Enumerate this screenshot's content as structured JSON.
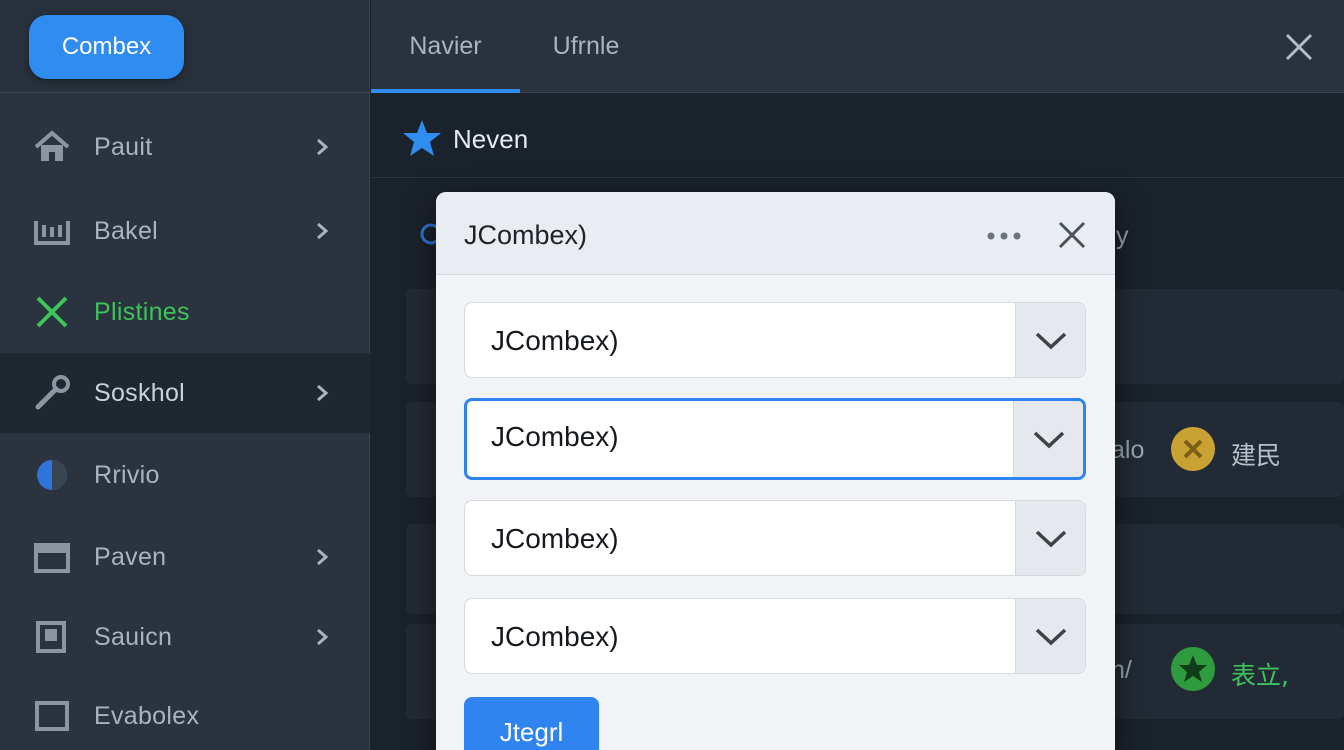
{
  "sidebar": {
    "brand_label": "Combex",
    "items": [
      {
        "label": "Pauit",
        "icon": "home-icon"
      },
      {
        "label": "Bakel",
        "icon": "tools-icon"
      },
      {
        "label": "Plistines",
        "icon": "close-x-icon",
        "color": "#3cc45a"
      },
      {
        "label": "Soskhol",
        "icon": "wrench-icon",
        "active": true
      },
      {
        "label": "Rrivio",
        "icon": "circle-icon"
      },
      {
        "label": "Paven",
        "icon": "wallet-icon"
      },
      {
        "label": "Sauicn",
        "icon": "document-icon"
      },
      {
        "label": "Evabolex",
        "icon": "square-icon"
      }
    ]
  },
  "topbar": {
    "tabs": [
      {
        "label": "Navier",
        "active": true
      },
      {
        "label": "Ufrnle",
        "active": false
      }
    ]
  },
  "main": {
    "title": "Neven",
    "background_rows": [
      {
        "text": "y"
      },
      {
        "text": "alo",
        "badge": "建民"
      },
      {
        "text": "n/",
        "badge": "表立,"
      }
    ]
  },
  "modal": {
    "title": "JCombex)",
    "combos": [
      {
        "value": "JCombex)",
        "focused": false
      },
      {
        "value": "JCombex)",
        "focused": true
      },
      {
        "value": "JCombex)",
        "focused": false
      },
      {
        "value": "JCombex)",
        "focused": false
      }
    ],
    "primary_button": "Jtegrl"
  },
  "colors": {
    "accent": "#2f8cf0",
    "success": "#3cc45a",
    "gold": "#c9a233"
  }
}
